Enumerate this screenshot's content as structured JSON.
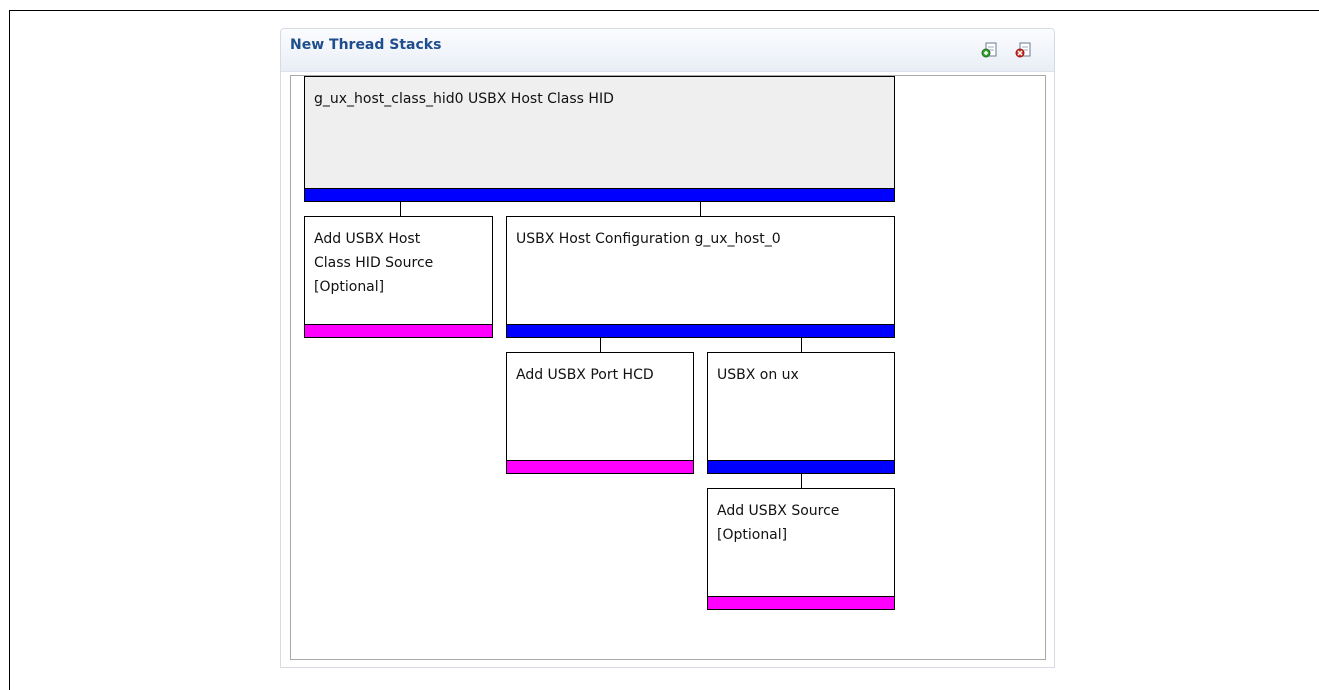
{
  "panel": {
    "title": "New Thread Stacks",
    "toolbar": {
      "new_stack_icon": "add-stack-icon",
      "remove_stack_icon": "remove-stack-icon"
    }
  },
  "blocks": {
    "hid": {
      "label": "g_ux_host_class_hid0 USBX Host Class HID",
      "bar": "blue"
    },
    "hid_source": {
      "label": "Add USBX Host\nClass HID Source\n[Optional]",
      "bar": "pink"
    },
    "host_config": {
      "label": "USBX Host Configuration g_ux_host_0",
      "bar": "blue"
    },
    "port_hcd": {
      "label": "Add USBX Port HCD",
      "bar": "pink"
    },
    "usbx_on_ux": {
      "label": "USBX on ux",
      "bar": "blue"
    },
    "usbx_source": {
      "label": "Add USBX Source\n[Optional]",
      "bar": "pink"
    }
  },
  "colors": {
    "bar_blue": "#0000ff",
    "bar_pink": "#ff00ff",
    "title_color": "#1f4e8c"
  }
}
